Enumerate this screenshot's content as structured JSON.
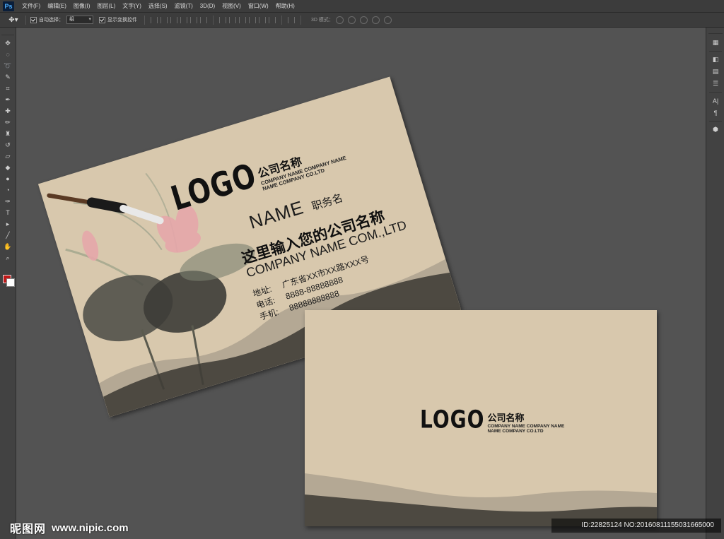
{
  "app": {
    "logo": "Ps",
    "menu": [
      "文件(F)",
      "编辑(E)",
      "图像(I)",
      "图层(L)",
      "文字(Y)",
      "选择(S)",
      "滤镜(T)",
      "3D(D)",
      "视图(V)",
      "窗口(W)",
      "帮助(H)"
    ]
  },
  "options": {
    "auto_select_label": "自动选择：",
    "auto_select_value": "组",
    "show_transform_label": "显示变换控件",
    "mode_3d_label": "3D 模式："
  },
  "front_card": {
    "logo": "LOGO",
    "company_name_cn": "公司名称",
    "company_en_line1": "COMPANY NAME COMPANY NAME",
    "company_en_line2": "NAME COMPANY CO.LTD",
    "person_name": "NAME",
    "person_title": "职务名",
    "company_full_cn": "这里输入您的公司名称",
    "company_full_en": "COMPANY NAME COM.,LTD",
    "contacts": [
      {
        "label": "地址:",
        "value": "广东省XX市XX路XXX号"
      },
      {
        "label": "电话:",
        "value": "8888-88888888"
      },
      {
        "label": "手机:",
        "value": "88888888888"
      }
    ]
  },
  "back_card": {
    "logo": "LOGO",
    "company_name_cn": "公司名称",
    "company_en_line1": "COMPANY NAME COMPANY NAME",
    "company_en_line2": "NAME COMPANY CO.LTD"
  },
  "watermark": {
    "brand": "昵图网",
    "url": "www.nipic.com",
    "id_text": "ID:22825124 NO:20160811155031665000"
  },
  "colors": {
    "card_bg": "#d8c8ad",
    "ink": "#3b3833",
    "foreground": "#c01818",
    "background": "#ffffff"
  }
}
